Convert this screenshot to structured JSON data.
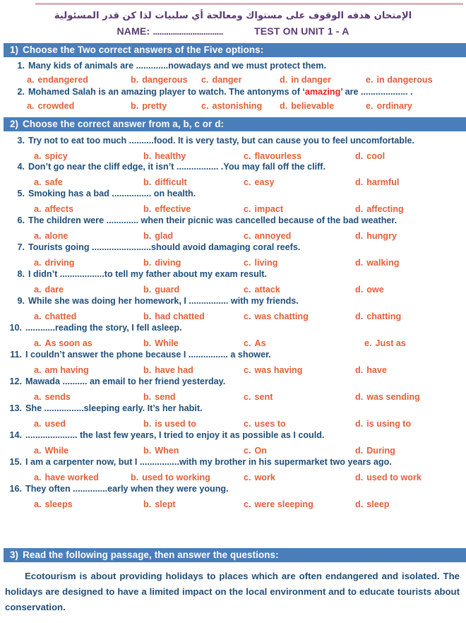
{
  "meta": {
    "accent_bar_color": "#4a7ebb",
    "question_text_color": "#1f4e79",
    "option_text_color": "#e2603a",
    "header_text_color": "#5b3a74",
    "highlight_color": "#ed1c1c",
    "top_rule_color": "#dcb4bc"
  },
  "header": {
    "arabic_instruction": "الإمتحان هدفه الوقوف على مستواك ومعالجة أي سلبيات لذا كن قدر المسئولية",
    "name_label": "NAME:",
    "name_dots": "................................",
    "test_title": "TEST ON UNIT 1  - A"
  },
  "sections": [
    {
      "number": "1)",
      "title": "Choose the Two correct answers of the Five options:"
    },
    {
      "number": "2)",
      "title": "Choose the correct answer from a, b, c or d:"
    },
    {
      "number": "3)",
      "title": "Read the following passage, then answer the questions:"
    }
  ],
  "questions": [
    {
      "num": "1.",
      "text_before": "Many kids of animals are .............nowadays and we must protect them.",
      "options": [
        {
          "letter": "a.",
          "text": "endangered"
        },
        {
          "letter": "b.",
          "text": "dangerous"
        },
        {
          "letter": "c.",
          "text": "danger"
        },
        {
          "letter": "d.",
          "text": "in danger"
        },
        {
          "letter": "e.",
          "text": "in dangerous"
        }
      ]
    },
    {
      "num": "2.",
      "text_before": "Mohamed Salah is an amazing player to watch. The antonyms of ‘",
      "highlight": "amazing",
      "text_after": "’ are ................... .",
      "options": [
        {
          "letter": "a.",
          "text": "crowded"
        },
        {
          "letter": "b.",
          "text": "pretty"
        },
        {
          "letter": "c.",
          "text": "astonishing"
        },
        {
          "letter": "d.",
          "text": "believable"
        },
        {
          "letter": "e.",
          "text": "ordinary"
        }
      ]
    },
    {
      "num": "3.",
      "text_before": "Try not to eat too much ..........food. It is very tasty, but can cause you to feel uncomfortable.",
      "options": [
        {
          "letter": "a.",
          "text": "spicy"
        },
        {
          "letter": "b.",
          "text": "healthy"
        },
        {
          "letter": "c.",
          "text": "flavourless"
        },
        {
          "letter": "d.",
          "text": "cool"
        }
      ]
    },
    {
      "num": "4.",
      "text_before": "Don’t go near the cliff edge, it isn’t ................. .You may fall off the cliff.",
      "options": [
        {
          "letter": "a.",
          "text": "safe"
        },
        {
          "letter": "b.",
          "text": "difficult"
        },
        {
          "letter": "c.",
          "text": "easy"
        },
        {
          "letter": "d.",
          "text": "harmful"
        }
      ]
    },
    {
      "num": "5.",
      "text_before": "Smoking has a bad ................ on health.",
      "options": [
        {
          "letter": "a.",
          "text": "affects"
        },
        {
          "letter": "b.",
          "text": "effective"
        },
        {
          "letter": "c.",
          "text": "impact"
        },
        {
          "letter": "d.",
          "text": "affecting"
        }
      ]
    },
    {
      "num": "6.",
      "text_before": "The children were ............. when their picnic was cancelled because of the bad weather.",
      "options": [
        {
          "letter": "a.",
          "text": "alone"
        },
        {
          "letter": "b.",
          "text": "glad"
        },
        {
          "letter": "c.",
          "text": "annoyed"
        },
        {
          "letter": "d.",
          "text": "hungry"
        }
      ]
    },
    {
      "num": "7.",
      "text_before": "Tourists going ........................should avoid damaging coral reefs.",
      "options": [
        {
          "letter": "a.",
          "text": "driving"
        },
        {
          "letter": "b.",
          "text": "diving"
        },
        {
          "letter": "c.",
          "text": "living"
        },
        {
          "letter": "d.",
          "text": "walking"
        }
      ]
    },
    {
      "num": "8.",
      "text_before": "I didn’t ..................to tell my father about my exam result.",
      "options": [
        {
          "letter": "a.",
          "text": "dare"
        },
        {
          "letter": "b.",
          "text": "guard"
        },
        {
          "letter": "c.",
          "text": "attack"
        },
        {
          "letter": "d.",
          "text": "owe"
        }
      ]
    },
    {
      "num": "9.",
      "text_before": "While she was doing her homework, I ................ with my friends.",
      "options": [
        {
          "letter": "a.",
          "text": "chatted"
        },
        {
          "letter": "b.",
          "text": "had chatted"
        },
        {
          "letter": "c.",
          "text": "was chatting"
        },
        {
          "letter": "d.",
          "text": "chatting"
        }
      ]
    },
    {
      "num": "10.",
      "text_before": "............reading the story, I fell asleep.",
      "options": [
        {
          "letter": "a.",
          "text": "As soon as"
        },
        {
          "letter": "b.",
          "text": "While"
        },
        {
          "letter": "c.",
          "text": "As"
        },
        {
          "letter": "e.",
          "text": "Just as"
        }
      ]
    },
    {
      "num": "11.",
      "text_before": "I couldn’t answer the phone because I ................ a shower.",
      "options": [
        {
          "letter": "a.",
          "text": "am having"
        },
        {
          "letter": "b.",
          "text": "have had"
        },
        {
          "letter": "c.",
          "text": "was having"
        },
        {
          "letter": "d.",
          "text": "have"
        }
      ]
    },
    {
      "num": "12.",
      "text_before": "Mawada .......... an email to her friend yesterday.",
      "options": [
        {
          "letter": "a.",
          "text": "sends"
        },
        {
          "letter": "b.",
          "text": "send"
        },
        {
          "letter": "c.",
          "text": "sent"
        },
        {
          "letter": "d.",
          "text": "was sending"
        }
      ]
    },
    {
      "num": "13.",
      "text_before": "She ................sleeping early. It’s her habit.",
      "options": [
        {
          "letter": "a.",
          "text": "used"
        },
        {
          "letter": "b.",
          "text": "is used to"
        },
        {
          "letter": "c.",
          "text": "uses to"
        },
        {
          "letter": "d.",
          "text": "is using to"
        }
      ]
    },
    {
      "num": "14.",
      "text_before": "..................... the last few years, I tried to enjoy it as possible as I could.",
      "options": [
        {
          "letter": "a.",
          "text": "While"
        },
        {
          "letter": "b.",
          "text": "When"
        },
        {
          "letter": "c.",
          "text": "On"
        },
        {
          "letter": "d.",
          "text": "During"
        }
      ]
    },
    {
      "num": "15.",
      "text_before": "I am a carpenter now, but I ................with my brother in his supermarket two years ago.",
      "options": [
        {
          "letter": "a.",
          "text": "have worked"
        },
        {
          "letter": "b.",
          "text": "used to working"
        },
        {
          "letter": "c.",
          "text": "work"
        },
        {
          "letter": "d.",
          "text": "used to work"
        }
      ]
    },
    {
      "num": "16.",
      "text_before": "They often ..............early when they were young.",
      "options": [
        {
          "letter": "a.",
          "text": "sleeps"
        },
        {
          "letter": "b.",
          "text": "slept"
        },
        {
          "letter": "c.",
          "text": "were sleeping"
        },
        {
          "letter": "d.",
          "text": "sleep"
        }
      ]
    }
  ],
  "passage": {
    "text": "Ecotourism is about providing holidays to places which are often endangered and isolated. The holidays are designed to have a limited impact on the local environment and to educate tourists about conservation."
  }
}
